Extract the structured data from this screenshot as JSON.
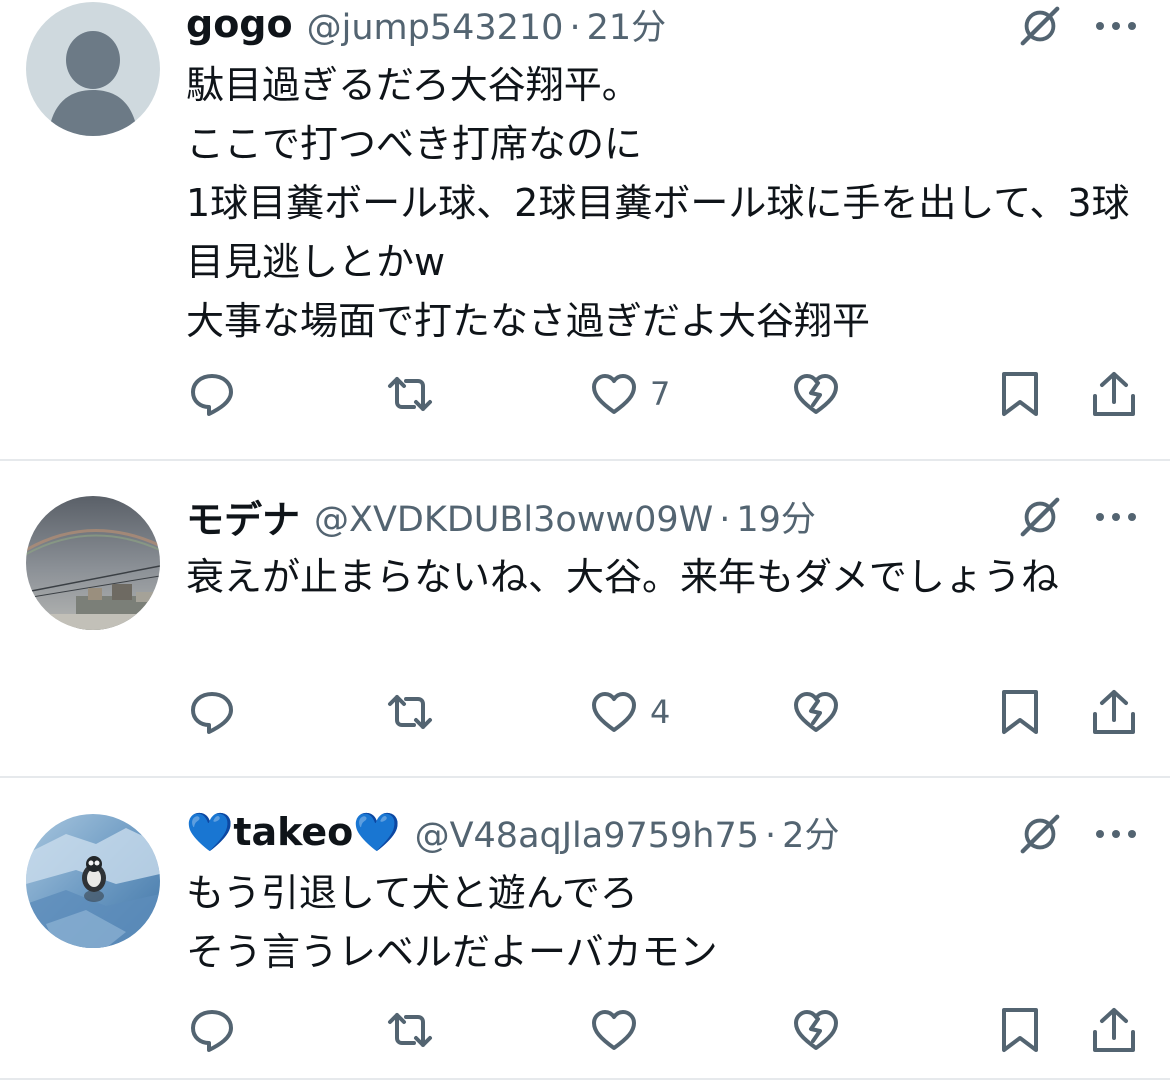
{
  "colors": {
    "text": "#0f1419",
    "secondary": "#536471",
    "divider": "#e6e9ec",
    "heart_emoji": "#1d5bf2"
  },
  "posts": [
    {
      "display_name": "gogo",
      "handle": "@jump543210",
      "separator": "·",
      "time": "21分",
      "avatar": "default-avatar",
      "text": "駄目過ぎるだろ大谷翔平。\nここで打つべき打席なのに\n1球目糞ボール球、2球目糞ボール球に手を出して、3球目見逃しとかw\n大事な場面で打たなさ過ぎだよ大谷翔平",
      "likes": "7"
    },
    {
      "display_name": "モデナ",
      "handle": "@XVDKDUBl3oww09W",
      "separator": "·",
      "time": "19分",
      "avatar": "rainbow-sky-photo",
      "text": "衰えが止まらないね、大谷。来年もダメでしょうね",
      "likes": "4"
    },
    {
      "display_name_prefix": "💙",
      "display_name": "takeo",
      "display_name_suffix": "💙",
      "handle": "@V48aqJla9759h75",
      "separator": "·",
      "time": "2分",
      "avatar": "penguin-on-ice-photo",
      "text": "もう引退して犬と遊んでろ\nそう言うレベルだよーバカモン",
      "likes": ""
    }
  ],
  "icons": {
    "reply": "reply-icon",
    "repost": "repost-icon",
    "like": "like-icon",
    "dislike": "broken-heart-icon",
    "bookmark": "bookmark-icon",
    "share": "share-icon",
    "grok": "grok-icon",
    "more": "more-icon"
  }
}
